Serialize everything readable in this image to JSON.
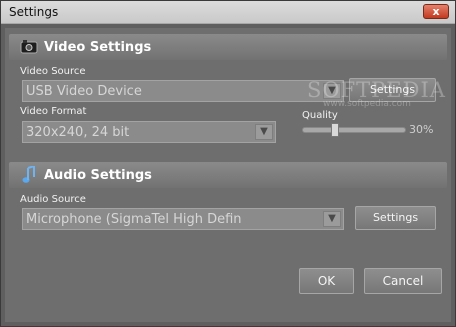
{
  "window": {
    "title": "Settings",
    "close_label": "x"
  },
  "video": {
    "section_title": "Video Settings",
    "source_label": "Video Source",
    "source_value": "USB Video Device",
    "source_settings_label": "Settings",
    "format_label": "Video Format",
    "format_value": "320x240, 24 bit",
    "quality_label": "Quality",
    "quality_value": "30%",
    "quality_fraction": 0.3
  },
  "audio": {
    "section_title": "Audio Settings",
    "source_label": "Audio Source",
    "source_value": "Microphone (SigmaTel High Defin",
    "settings_label": "Settings"
  },
  "footer": {
    "ok_label": "OK",
    "cancel_label": "Cancel"
  },
  "watermark": {
    "brand": "SOFTPEDIA",
    "url": "www.softpedia.com"
  },
  "icons": {
    "video": "video-camera-icon",
    "audio": "music-note-icon",
    "dropdown": "chevron-down-icon"
  },
  "colors": {
    "panel": "#6e6e6e",
    "section_band": "#8a8a8a",
    "text": "#ffffff"
  }
}
